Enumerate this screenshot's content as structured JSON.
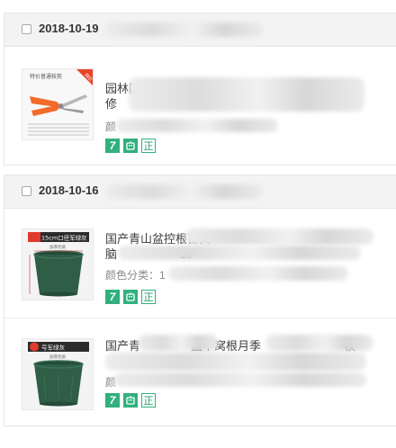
{
  "orders": [
    {
      "date": "2018-10-19",
      "items": [
        {
          "title_line1": "园林园艺",
          "title_line2": "修",
          "sku_label": "颜",
          "thumb_banner": "特价普通枝剪",
          "thumb_corner": "特价"
        }
      ]
    },
    {
      "date": "2018-10-16",
      "items": [
        {
          "title_line1": "国产青山盆控根苗尖",
          "title_line2": "脑",
          "title_line2b": "10 ",
          "sku_label": "颜色分类：",
          "sku_value": "1",
          "thumb_banner": "15cm口径军绿灰",
          "thumb_sub": "加厚优质"
        },
        {
          "title_line1": "国产青",
          "title_line1b": "盆不窝根月季",
          "title_line1c": "枚",
          "sku_label": "颜",
          "thumb_banner": "号军绿灰",
          "thumb_sub": "加厚优质"
        }
      ]
    }
  ],
  "badges": {
    "seven_day": "7",
    "zheng": "正"
  },
  "colors": {
    "badge_green": "#31b07e",
    "header_bg": "#f3f3f3",
    "pot_green": "#2f5d46"
  },
  "icons": [
    "seven-day-return-icon",
    "robot-service-icon",
    "genuine-icon"
  ]
}
